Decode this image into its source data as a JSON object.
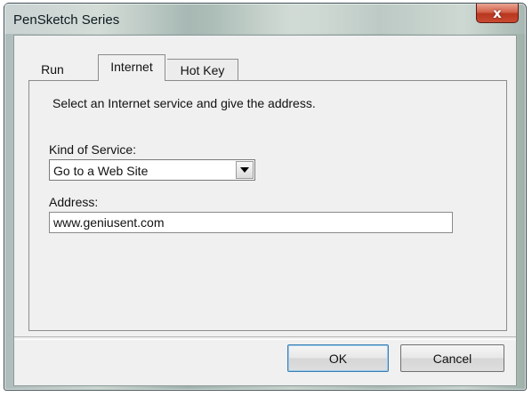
{
  "window": {
    "title": "PenSketch Series",
    "close_symbol": "x",
    "icons": {
      "close": "close-icon",
      "dropdown": "chevron-down-icon"
    }
  },
  "tabs": [
    {
      "label": "Run",
      "selected": false
    },
    {
      "label": "Internet",
      "selected": true
    },
    {
      "label": "Hot Key",
      "selected": false
    }
  ],
  "internet_panel": {
    "instruction": "Select an Internet service and give the address.",
    "kind_label": "Kind of Service:",
    "kind_value": "Go to a Web Site",
    "address_label": "Address:",
    "address_value": "www.geniusent.com"
  },
  "buttons": {
    "ok": "OK",
    "cancel": "Cancel"
  },
  "colors": {
    "close_button": "#c84a30",
    "client_background": "#f0f0f0",
    "default_button_border": "#3c7fb1"
  }
}
